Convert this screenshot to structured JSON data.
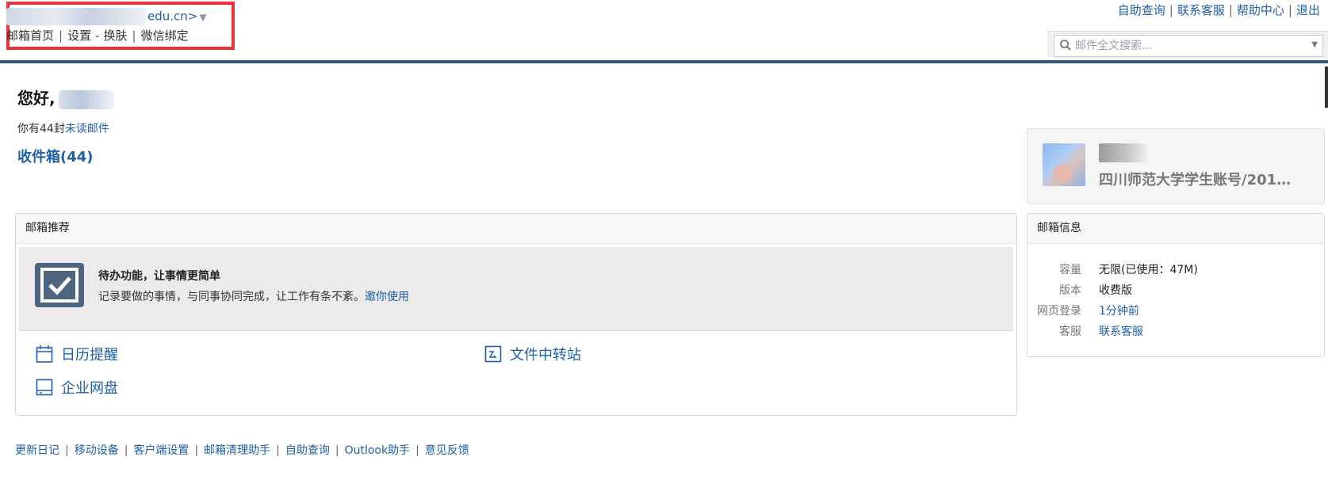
{
  "header": {
    "account_suffix": "edu.cn>",
    "nav": [
      "邮箱首页",
      "设置",
      "换肤",
      "微信绑定"
    ],
    "nav_dash": "-",
    "right_links": [
      "自助查询",
      "联系客服",
      "帮助中心",
      "退出"
    ],
    "search_placeholder": "邮件全文搜索..."
  },
  "greeting": {
    "hello": "您好,",
    "unread_prefix": "你有44封",
    "unread_link": "未读邮件",
    "inbox": "收件箱(44)"
  },
  "recommend": {
    "title": "邮箱推荐",
    "todo_title": "待办功能，让事情更简单",
    "todo_desc": "记录要做的事情，与同事协同完成，让工作有条不紊。",
    "todo_link": "邀你使用",
    "features": [
      "日历提醒",
      "文件中转站",
      "企业网盘"
    ]
  },
  "footer": [
    "更新日记",
    "移动设备",
    "客户端设置",
    "邮箱清理助手",
    "自助查询",
    "Outlook助手",
    "意见反馈"
  ],
  "user_card": {
    "org": "四川师范大学学生账号/2018..."
  },
  "mailbox_info": {
    "title": "邮箱信息",
    "rows": [
      {
        "key": "容量",
        "value": "无限(已使用：47M)"
      },
      {
        "key": "版本",
        "value": "收费版"
      },
      {
        "key": "网页登录",
        "value": "1分钟前"
      },
      {
        "key": "客服",
        "value": "联系客服"
      }
    ]
  },
  "colors": {
    "link": "#1f5fa6",
    "highlight_box": "#e8343a",
    "header_line": "#36587a",
    "todo_icon_bg": "#4e6580"
  }
}
